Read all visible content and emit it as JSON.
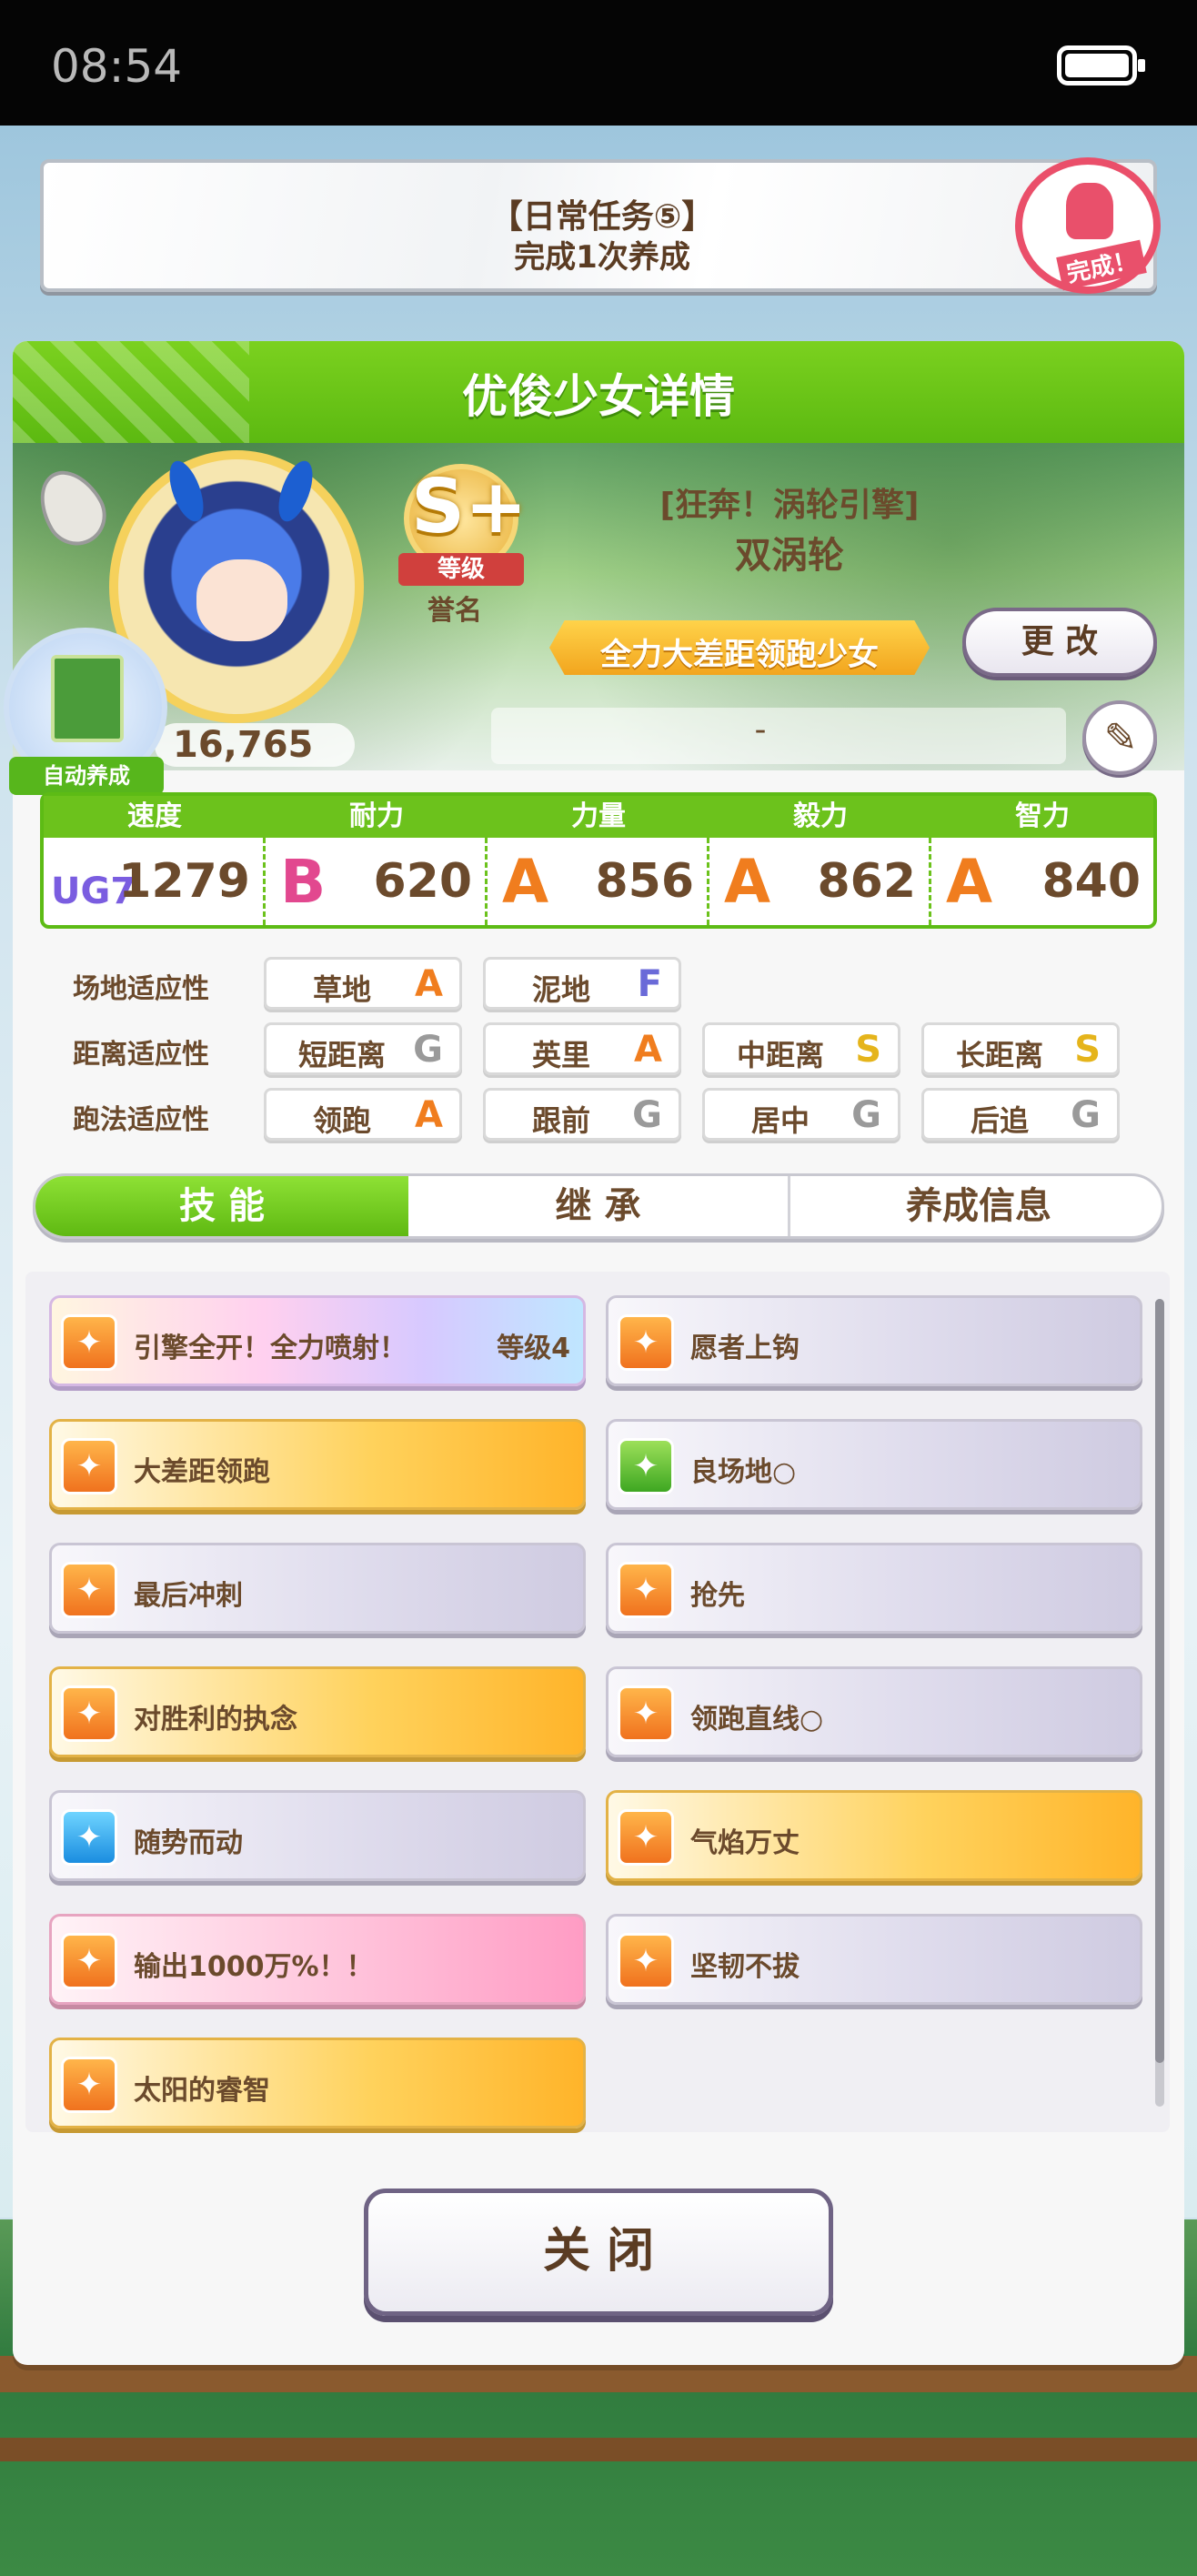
{
  "status_bar": {
    "time": "08:54"
  },
  "quest": {
    "title": "【日常任务⑤】",
    "subtitle": "完成1次养成",
    "stamp": "完成！"
  },
  "header": {
    "title": "优俊少女详情"
  },
  "profile": {
    "fans": "16,765",
    "auto_badge": "自动养成",
    "rank_letter": "S+",
    "rank_label": "等级",
    "title_label": "誉名",
    "alias": "[狂奔！涡轮引擎]",
    "name": "双涡轮",
    "title": "全力大差距领跑少女",
    "change_label": "更 改",
    "memo": "-"
  },
  "stats": [
    {
      "label": "速度",
      "grade": "UG7",
      "value": "1279",
      "color": "#7a5de0"
    },
    {
      "label": "耐力",
      "grade": "B",
      "value": "620",
      "color": "#e2488f"
    },
    {
      "label": "力量",
      "grade": "A",
      "value": "856",
      "color": "#f07d1e"
    },
    {
      "label": "毅力",
      "grade": "A",
      "value": "862",
      "color": "#f07d1e"
    },
    {
      "label": "智力",
      "grade": "A",
      "value": "840",
      "color": "#f07d1e"
    }
  ],
  "aptitude": {
    "track": {
      "label": "场地适应性",
      "items": [
        {
          "name": "草地",
          "grade": "A"
        },
        {
          "name": "泥地",
          "grade": "F"
        }
      ]
    },
    "distance": {
      "label": "距离适应性",
      "items": [
        {
          "name": "短距离",
          "grade": "G"
        },
        {
          "name": "英里",
          "grade": "A"
        },
        {
          "name": "中距离",
          "grade": "S"
        },
        {
          "name": "长距离",
          "grade": "S"
        }
      ]
    },
    "style": {
      "label": "跑法适应性",
      "items": [
        {
          "name": "领跑",
          "grade": "A"
        },
        {
          "name": "跟前",
          "grade": "G"
        },
        {
          "name": "居中",
          "grade": "G"
        },
        {
          "name": "后追",
          "grade": "G"
        }
      ]
    }
  },
  "tabs": [
    "技 能",
    "继 承",
    "养成信息"
  ],
  "skills": [
    {
      "name": "引擎全开！全力喷射！",
      "level": "等级4",
      "style": "rainbow"
    },
    {
      "name": "愿者上钩",
      "style": "purple"
    },
    {
      "name": "大差距领跑",
      "style": "gold"
    },
    {
      "name": "良场地○",
      "style": "purple"
    },
    {
      "name": "最后冲刺",
      "style": "purple"
    },
    {
      "name": "抢先",
      "style": "purple"
    },
    {
      "name": "对胜利的执念",
      "style": "gold"
    },
    {
      "name": "领跑直线○",
      "style": "purple"
    },
    {
      "name": "随势而动",
      "style": "purple"
    },
    {
      "name": "气焰万丈",
      "style": "gold"
    },
    {
      "name": "输出1000万%！！",
      "style": "pink"
    },
    {
      "name": "坚韧不拔",
      "style": "purple"
    },
    {
      "name": "太阳的睿智",
      "style": "gold"
    }
  ],
  "close_label": "关 闭"
}
